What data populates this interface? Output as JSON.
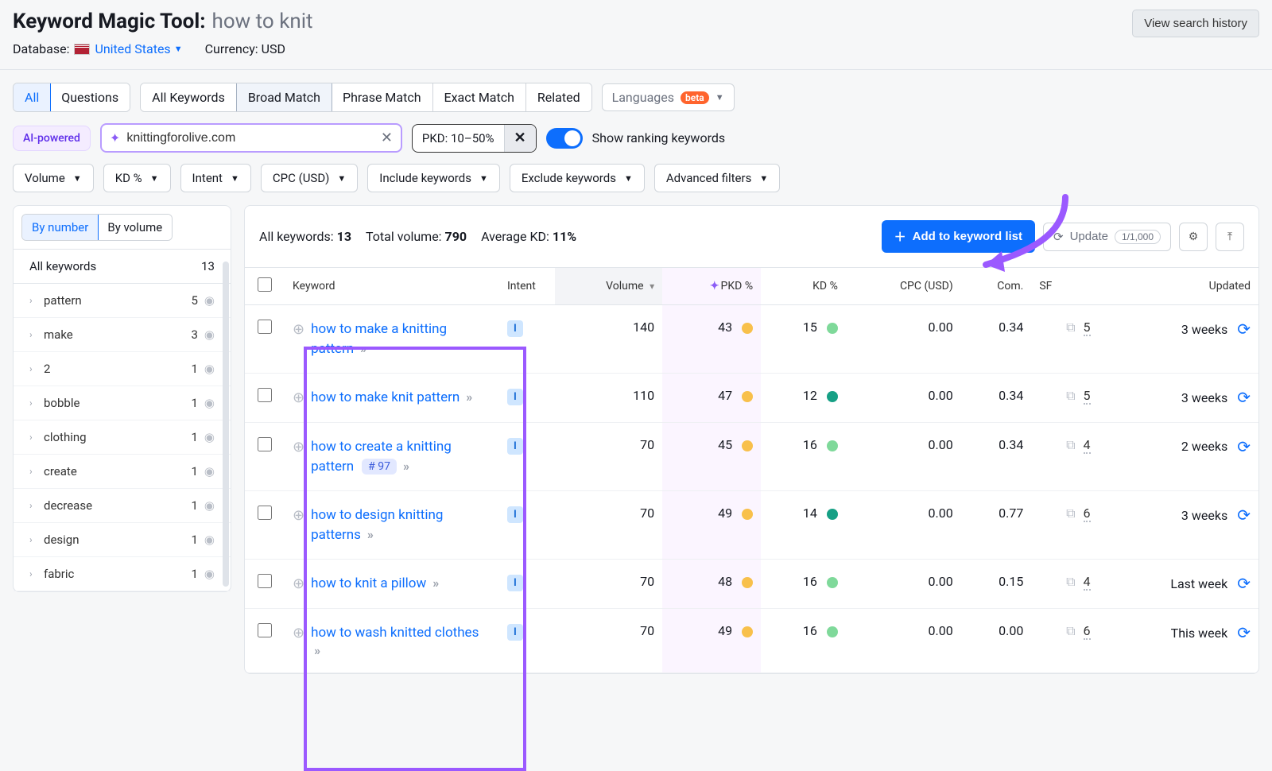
{
  "header": {
    "title": "Keyword Magic Tool:",
    "query": "how to knit",
    "database_label": "Database:",
    "database_value": "United States",
    "currency_label": "Currency: USD",
    "history_btn": "View search history"
  },
  "tabs": {
    "main": [
      "All",
      "Questions"
    ],
    "match": [
      "All Keywords",
      "Broad Match",
      "Phrase Match",
      "Exact Match",
      "Related"
    ],
    "match_active": 1,
    "languages": "Languages",
    "beta": "beta"
  },
  "row2": {
    "ai_badge": "AI-powered",
    "domain": "knittingforolive.com",
    "pkd_chip": "PKD: 10–50%",
    "toggle_label": "Show ranking keywords"
  },
  "filters": [
    "Volume",
    "KD %",
    "Intent",
    "CPC (USD)",
    "Include keywords",
    "Exclude keywords",
    "Advanced filters"
  ],
  "sidebar": {
    "tabs": [
      "By number",
      "By volume"
    ],
    "head_label": "All keywords",
    "head_count": "13",
    "items": [
      {
        "label": "pattern",
        "count": "5"
      },
      {
        "label": "make",
        "count": "3"
      },
      {
        "label": "2",
        "count": "1"
      },
      {
        "label": "bobble",
        "count": "1"
      },
      {
        "label": "clothing",
        "count": "1"
      },
      {
        "label": "create",
        "count": "1"
      },
      {
        "label": "decrease",
        "count": "1"
      },
      {
        "label": "design",
        "count": "1"
      },
      {
        "label": "fabric",
        "count": "1"
      }
    ]
  },
  "summary": {
    "all_kw_label": "All keywords:",
    "all_kw": "13",
    "total_vol_label": "Total volume:",
    "total_vol": "790",
    "avg_kd_label": "Average KD:",
    "avg_kd": "11%",
    "add_btn": "Add to keyword list",
    "update_btn": "Update",
    "update_count": "1/1,000"
  },
  "columns": {
    "keyword": "Keyword",
    "intent": "Intent",
    "volume": "Volume",
    "pkd": "PKD %",
    "kd": "KD %",
    "cpc": "CPC (USD)",
    "com": "Com.",
    "sf": "SF",
    "updated": "Updated"
  },
  "rows": [
    {
      "keyword": "how to make a knitting pattern",
      "rank": "",
      "volume": "140",
      "pkd": "43",
      "pkd_dot": "d-yellow",
      "kd": "15",
      "kd_dot": "d-green",
      "cpc": "0.00",
      "com": "0.34",
      "sf": "5",
      "updated": "3 weeks"
    },
    {
      "keyword": "how to make knit pattern",
      "rank": "",
      "volume": "110",
      "pkd": "47",
      "pkd_dot": "d-yellow",
      "kd": "12",
      "kd_dot": "d-teal",
      "cpc": "0.00",
      "com": "0.34",
      "sf": "5",
      "updated": "3 weeks"
    },
    {
      "keyword": "how to create a knitting pattern",
      "rank": "# 97",
      "volume": "70",
      "pkd": "45",
      "pkd_dot": "d-yellow",
      "kd": "16",
      "kd_dot": "d-green",
      "cpc": "0.00",
      "com": "0.34",
      "sf": "4",
      "updated": "2 weeks"
    },
    {
      "keyword": "how to design knitting patterns",
      "rank": "",
      "volume": "70",
      "pkd": "49",
      "pkd_dot": "d-yellow",
      "kd": "14",
      "kd_dot": "d-teal",
      "cpc": "0.00",
      "com": "0.77",
      "sf": "6",
      "updated": "3 weeks"
    },
    {
      "keyword": "how to knit a pillow",
      "rank": "",
      "volume": "70",
      "pkd": "48",
      "pkd_dot": "d-yellow",
      "kd": "16",
      "kd_dot": "d-green",
      "cpc": "0.00",
      "com": "0.15",
      "sf": "4",
      "updated": "Last week"
    },
    {
      "keyword": "how to wash knitted clothes",
      "rank": "",
      "volume": "70",
      "pkd": "49",
      "pkd_dot": "d-yellow",
      "kd": "16",
      "kd_dot": "d-green",
      "cpc": "0.00",
      "com": "0.00",
      "sf": "6",
      "updated": "This week"
    }
  ]
}
